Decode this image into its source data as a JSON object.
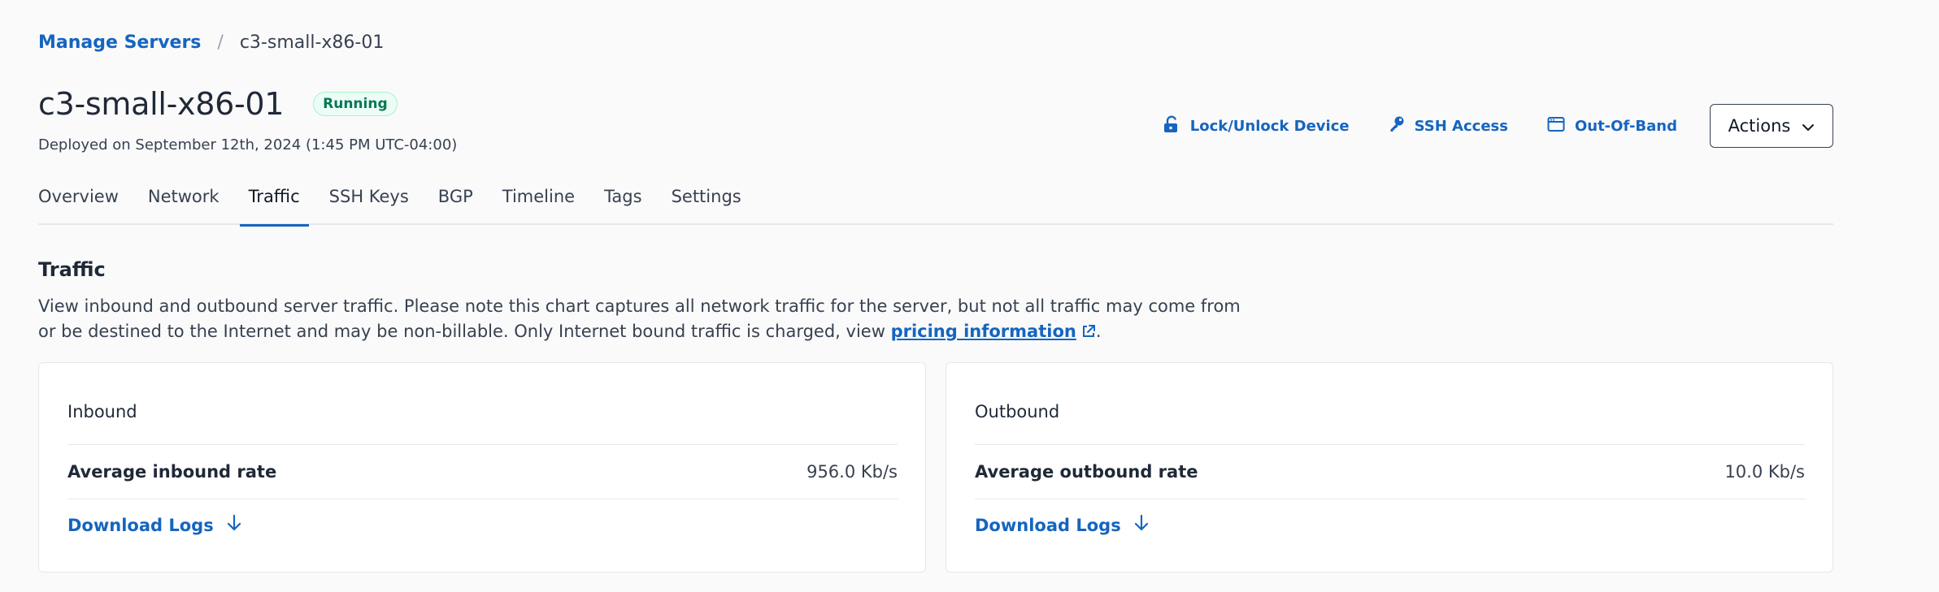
{
  "breadcrumb": {
    "parent": "Manage Servers",
    "separator": "/",
    "current": "c3-small-x86-01"
  },
  "header": {
    "title": "c3-small-x86-01",
    "status": "Running",
    "deployed": "Deployed on September 12th, 2024 (1:45 PM UTC-04:00)",
    "actions": {
      "lock": "Lock/Unlock Device",
      "ssh": "SSH Access",
      "oob": "Out-Of-Band",
      "menu": "Actions"
    }
  },
  "tabs": [
    {
      "label": "Overview"
    },
    {
      "label": "Network"
    },
    {
      "label": "Traffic",
      "active": true
    },
    {
      "label": "SSH Keys"
    },
    {
      "label": "BGP"
    },
    {
      "label": "Timeline"
    },
    {
      "label": "Tags"
    },
    {
      "label": "Settings"
    }
  ],
  "traffic": {
    "title": "Traffic",
    "description_before": "View inbound and outbound server traffic. Please note this chart captures all network traffic for the server, but not all traffic may come from or be destined to the Internet and may be non-billable. Only Internet bound traffic is charged, view ",
    "pricing_link": "pricing information",
    "description_after": "."
  },
  "inbound": {
    "title": "Inbound",
    "rate_label": "Average inbound rate",
    "rate_value": "956.0 Kb/s",
    "download": "Download Logs"
  },
  "outbound": {
    "title": "Outbound",
    "rate_label": "Average outbound rate",
    "rate_value": "10.0 Kb/s",
    "download": "Download Logs"
  },
  "colors": {
    "accent": "#1565c0",
    "status_green": "#047857"
  }
}
